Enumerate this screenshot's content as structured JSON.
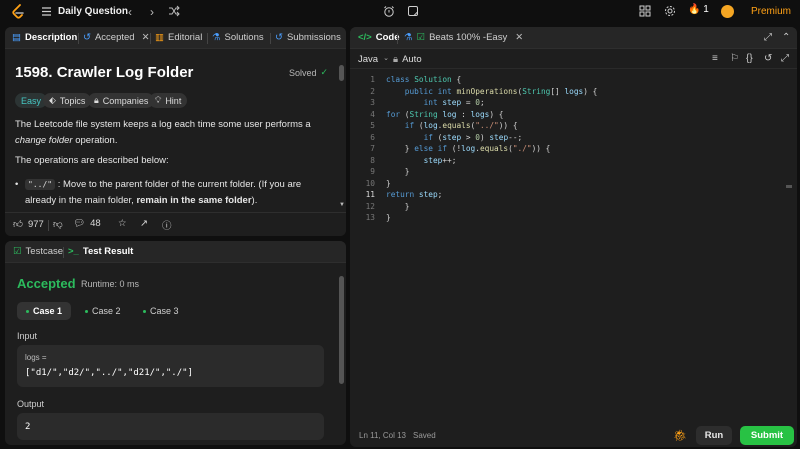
{
  "topbar": {
    "title": "Daily Question",
    "streak": "1",
    "premium": "Premium"
  },
  "desc_tabs": [
    {
      "label": "Description"
    },
    {
      "label": "Accepted"
    },
    {
      "label": "Editorial"
    },
    {
      "label": "Solutions"
    },
    {
      "label": "Submissions"
    }
  ],
  "problem": {
    "title": "1598. Crawler Log Folder",
    "status": "Solved",
    "difficulty": "Easy",
    "chips": [
      "Topics",
      "Companies",
      "Hint"
    ],
    "para1_a": "The Leetcode file system keeps a log each time some user performs a ",
    "para1_em": "change folder",
    "para1_b": " operation.",
    "para2": "The operations are described below:",
    "bullet_code": "\"../\"",
    "bullet_a": " : Move to the parent folder of the current folder. (If you are already in the main folder, ",
    "bullet_strong": "remain in the same folder",
    "bullet_b": ")."
  },
  "desc_footer": {
    "likes": "977",
    "comments": "48"
  },
  "result": {
    "tabs": [
      "Testcase",
      "Test Result"
    ],
    "status": "Accepted",
    "runtime": "Runtime: 0 ms",
    "cases": [
      "Case 1",
      "Case 2",
      "Case 3"
    ],
    "input_label": "Input",
    "input_var": "logs =",
    "input_value": "[\"d1/\",\"d2/\",\"../\",\"d21/\",\"./\"]",
    "output_label": "Output",
    "output_value": "2"
  },
  "editor": {
    "tabs": [
      "Code",
      "Beats 100% -Easy"
    ],
    "language": "Java",
    "mode": "Auto",
    "status_pos": "Ln 11, Col 13",
    "status_saved": "Saved",
    "line_numbers": [
      "1",
      "2",
      "3",
      "4",
      "5",
      "6",
      "7",
      "8",
      "9",
      "10",
      "11",
      "12",
      "13"
    ],
    "run": "Run",
    "submit": "Submit"
  }
}
